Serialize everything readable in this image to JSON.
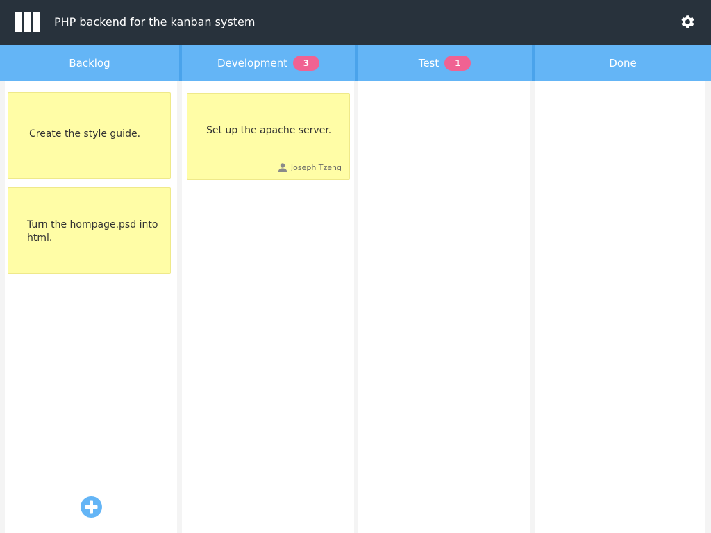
{
  "app": {
    "title": "PHP backend for the kanban system"
  },
  "columns": [
    {
      "title": "Backlog",
      "count": null
    },
    {
      "title": "Development",
      "count": "3"
    },
    {
      "title": "Test",
      "count": "1"
    },
    {
      "title": "Done",
      "count": null
    }
  ],
  "cards": {
    "backlog": [
      {
        "text": "Create the style guide."
      },
      {
        "text": "Turn the hompage.psd into html."
      }
    ],
    "development": [
      {
        "text": "Set up the apache server.",
        "owner": "Joseph Tzeng"
      }
    ]
  },
  "icons": {
    "logo": "board-columns-icon",
    "settings": "gear-icon",
    "add": "plus-circle-icon",
    "owner": "user-icon"
  },
  "colors": {
    "topbar": "#28323c",
    "column_header": "#64b5f6",
    "badge": "#f06292",
    "card": "#fffda6",
    "add_button": "#64b5f6"
  }
}
